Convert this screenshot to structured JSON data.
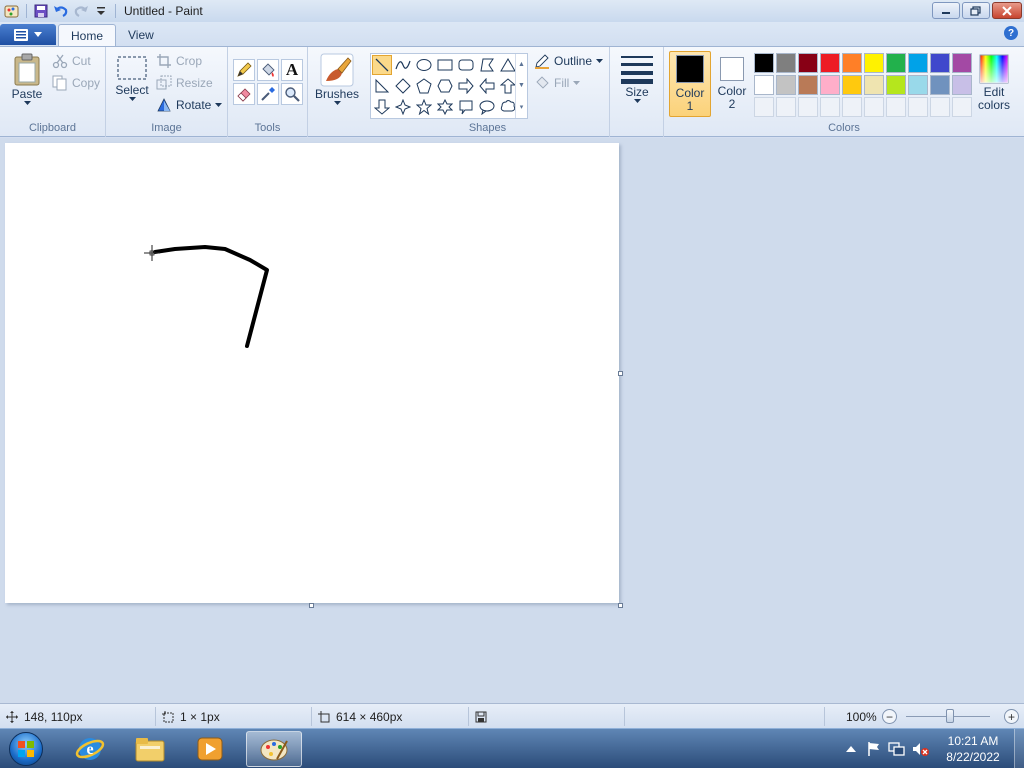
{
  "window": {
    "title": "Untitled - Paint"
  },
  "tabs": [
    {
      "label": "Home"
    },
    {
      "label": "View"
    }
  ],
  "clipboard": {
    "label": "Clipboard",
    "paste": "Paste",
    "cut": "Cut",
    "copy": "Copy"
  },
  "image": {
    "label": "Image",
    "select": "Select",
    "crop": "Crop",
    "resize": "Resize",
    "rotate": "Rotate"
  },
  "tools": {
    "label": "Tools",
    "text_glyph": "A"
  },
  "brushes": {
    "label": "Brushes"
  },
  "shapes": {
    "label": "Shapes",
    "outline": "Outline",
    "fill": "Fill"
  },
  "size": {
    "label": "Size"
  },
  "colors": {
    "label": "Colors",
    "color1_line1": "Color",
    "color1_line2": "1",
    "color2_line1": "Color",
    "color2_line2": "2",
    "edit_line1": "Edit",
    "edit_line2": "colors",
    "color1_value": "#000000",
    "color2_value": "#ffffff",
    "row1": [
      "#000000",
      "#7f7f7f",
      "#880015",
      "#ed1c24",
      "#ff7f27",
      "#fff200",
      "#22b14c",
      "#00a2e8",
      "#3f48cc",
      "#a349a4"
    ],
    "row2": [
      "#ffffff",
      "#c3c3c3",
      "#b97a57",
      "#ffaec9",
      "#ffc90e",
      "#efe4b0",
      "#b5e61d",
      "#99d9ea",
      "#7092be",
      "#c8bfe7"
    ]
  },
  "status": {
    "cursor_pos": "148, 110px",
    "selection_size": "1 × 1px",
    "image_size": "614 × 460px",
    "zoom": "100%",
    "zoom_minus": "−",
    "zoom_plus": "+"
  },
  "taskbar": {
    "time": "10:21 AM",
    "date": "8/22/2022"
  }
}
